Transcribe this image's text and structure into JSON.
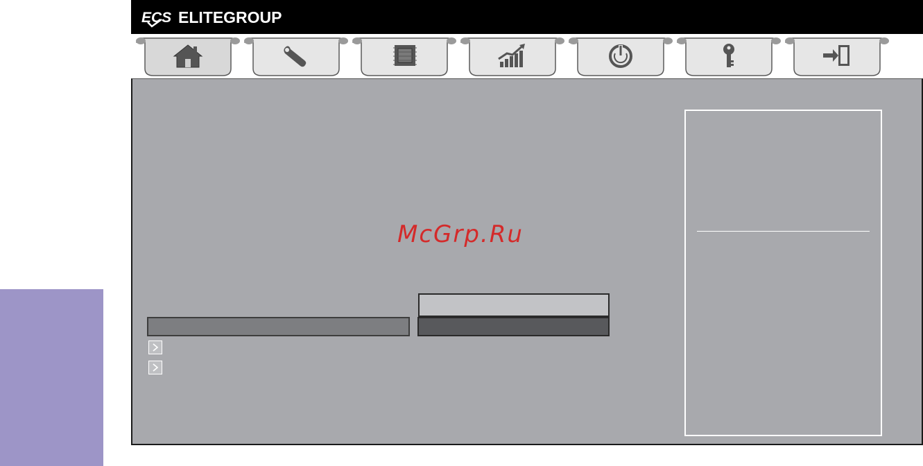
{
  "brand": {
    "mark": "ECS",
    "name": "ELITEGROUP"
  },
  "tabs": [
    {
      "label": "Main",
      "icon": "home-icon"
    },
    {
      "label": "Advanced",
      "icon": "wrench-icon"
    },
    {
      "label": "Chipset",
      "icon": "chip-icon"
    },
    {
      "label": "M.I.B",
      "icon": "performance-chart-icon"
    },
    {
      "label": "Boot",
      "icon": "power-icon"
    },
    {
      "label": "Security",
      "icon": "key-icon"
    },
    {
      "label": "Exit",
      "icon": "exit-door-icon"
    }
  ],
  "watermark": "McGrp.Ru",
  "colors": {
    "header": "#000000",
    "panel": "#a8a9ad",
    "side_tab": "#9d95c7",
    "watermark": "#d42a2a"
  }
}
